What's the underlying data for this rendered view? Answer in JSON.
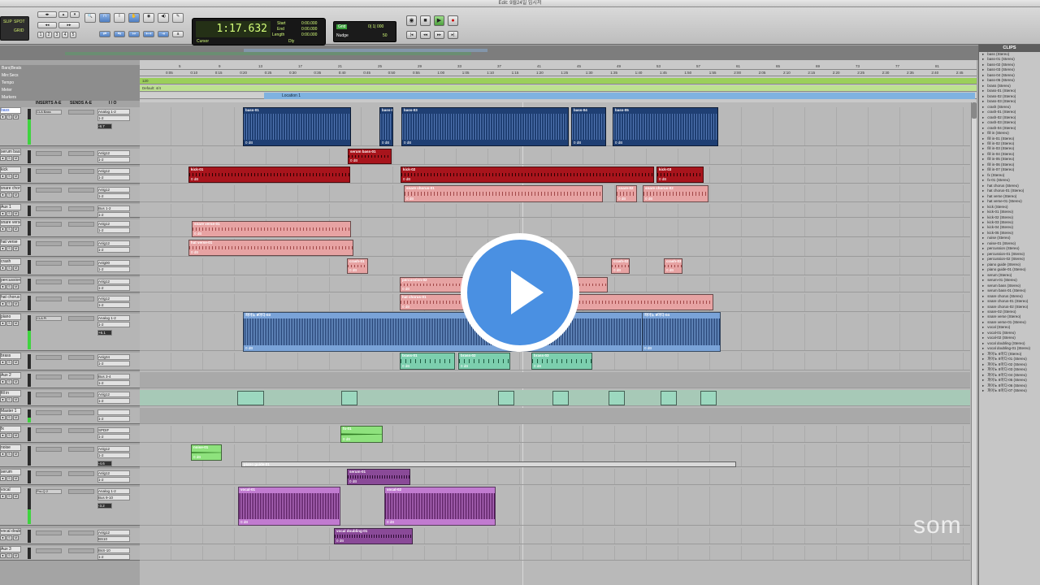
{
  "window": {
    "title": "Edit: 9월24일 임시저"
  },
  "toolbar": {
    "mode_labels": [
      "SLIP",
      "SPOT",
      "GRID"
    ],
    "counter_main": "1:17.632",
    "counter_start_label": "Start",
    "counter_end_label": "End",
    "counter_length_label": "Length",
    "counter_start": "0:00.000",
    "counter_end": "0:00.000",
    "counter_length": "0:00.000",
    "cursor_label": "Cursor",
    "dly_label": "Dly",
    "grid_label": "Grid",
    "grid_value": "0| 1| 000",
    "nudge_label": "Nudge",
    "nudge_value": "50",
    "zoom_buttons": [
      "1",
      "2",
      "3",
      "4",
      "5"
    ]
  },
  "ruler_labels": {
    "header_rows": [
      "Bars|Beats",
      "Min:Secs",
      "Tempo",
      "Meter",
      "Markers"
    ],
    "bars": [
      "5",
      "9",
      "13",
      "17",
      "21",
      "25",
      "29",
      "33",
      "37",
      "41",
      "45",
      "49",
      "53",
      "57",
      "61",
      "65",
      "69",
      "73",
      "77",
      "81"
    ],
    "minsecs": [
      "0:05",
      "0:10",
      "0:15",
      "0:20",
      "0:25",
      "0:30",
      "0:35",
      "0:40",
      "0:45",
      "0:50",
      "0:55",
      "1:00",
      "1:05",
      "1:10",
      "1:15",
      "1:20",
      "1:25",
      "1:30",
      "1:35",
      "1:40",
      "1:45",
      "1:50",
      "1:55",
      "2:00",
      "2:05",
      "2:10",
      "2:15",
      "2:20",
      "2:25",
      "2:30",
      "2:35",
      "2:40",
      "2:45"
    ],
    "tempo": "120",
    "meter": "Default: 4/4",
    "location": "Location 1"
  },
  "column_heads": {
    "inserts": "INSERTS A-E",
    "sends": "SENDS A-E",
    "io": "I / O"
  },
  "tracks": [
    {
      "name": "bass",
      "insert": "CLA Bass",
      "io_in": "Analog 1-2",
      "io_out": "1-2",
      "vol": "-8.7"
    },
    {
      "name": "serum bass",
      "insert": "",
      "io_in": "Anlg12",
      "io_out": "1-2",
      "vol": "-2.6"
    },
    {
      "name": "kick",
      "insert": "",
      "io_in": "Anlg12",
      "io_out": "1-2",
      "vol": "-7.8"
    },
    {
      "name": "snare chorus",
      "insert": "",
      "io_in": "Anlg12",
      "io_out": "1-2",
      "vol": "-8.1"
    },
    {
      "name": "Aux 1",
      "insert": "",
      "io_in": "Bus 1-2",
      "io_out": "1-2",
      "vol": "0.0"
    },
    {
      "name": "snare verse",
      "insert": "",
      "io_in": "Anlg12",
      "io_out": "1-2",
      "vol": "-5.1"
    },
    {
      "name": "hat verse",
      "insert": "",
      "io_in": "Anlg12",
      "io_out": "1-2",
      "vol": "-5.7"
    },
    {
      "name": "crash",
      "insert": "",
      "io_in": "Anlg00",
      "io_out": "1-2",
      "vol": "-4.6"
    },
    {
      "name": "percussion",
      "insert": "",
      "io_in": "Anlg12",
      "io_out": "1-2",
      "vol": "-5.8"
    },
    {
      "name": "hat chorus",
      "insert": "",
      "io_in": "Anlg12",
      "io_out": "1-2",
      "vol": "-7.2"
    },
    {
      "name": "piano",
      "insert": "CLA Pi",
      "io_in": "Analog 1-2",
      "io_out": "1-2",
      "vol": "+6.1"
    },
    {
      "name": "brass",
      "insert": "",
      "io_in": "Anlg34",
      "io_out": "1-2",
      "vol": "-2.6"
    },
    {
      "name": "Aux 2",
      "insert": "",
      "io_in": "Bus 3-4",
      "io_out": "1-2",
      "vol": "0.0"
    },
    {
      "name": "fill in",
      "insert": "",
      "io_in": "Anlg12",
      "io_out": "1-2",
      "vol": "-7.3"
    },
    {
      "name": "Master 1",
      "insert": "",
      "io_in": "",
      "io_out": "1-2",
      "vol": "0.0"
    },
    {
      "name": "fx",
      "insert": "",
      "io_in": "SPDIF",
      "io_out": "1-2",
      "vol": "-6.0"
    },
    {
      "name": "noise",
      "insert": "",
      "io_in": "Anlg12",
      "io_out": "1-2",
      "vol": "-4.6"
    },
    {
      "name": "serum",
      "insert": "",
      "io_in": "Anlg12",
      "io_out": "1-2",
      "vol": "-5.2"
    },
    {
      "name": "vocal",
      "insert": "Pro-Q 2",
      "io_in": "Analog 1-2",
      "io_out": "Bus 9-10",
      "vol": "-3.2"
    },
    {
      "name": "vocal doubling",
      "insert": "",
      "io_in": "Anlg12",
      "io_out": "BS10",
      "vol": "-4.1"
    },
    {
      "name": "Aux 3",
      "insert": "",
      "io_in": "BsS-10",
      "io_out": "1-2",
      "vol": "0.0"
    }
  ],
  "clips": {
    "bass": [
      "bass-01",
      "bass-02",
      "bass-03",
      "bass-04",
      "bass-05"
    ],
    "serum_bass": "serum bass-01",
    "kick": [
      "kick-01",
      "kick-02",
      "kick-03"
    ],
    "snare_chorus": [
      "snare chorus-01",
      "snare-02",
      "snare chorus-02"
    ],
    "snare_verse": "snare verse-01",
    "hat_verse": "hat verse-01",
    "crash": [
      "crash-01",
      "crash-02",
      "crash-03"
    ],
    "percussion": "percussion-02",
    "hat_chorus": "hat chorus-01",
    "piano": [
      "피아노 8마디-03",
      "피아노 8마디-04"
    ],
    "brass": [
      "brass-01",
      "brass-02",
      "brass-03"
    ],
    "fx": "fx-01",
    "noise": "noise-01",
    "piano_guide": "piano guide-01",
    "serum": "serum-01",
    "vocal": [
      "vocal-01",
      "vocal-02"
    ],
    "vocal_doubling": "vocal doubling-01",
    "gain": "0 dB"
  },
  "clip_list": {
    "title": "CLIPS",
    "items": [
      "bass (Stereo)",
      "bass-01 (Stereo)",
      "bass-02 (Stereo)",
      "bass-03 (Stereo)",
      "bass-04 (Stereo)",
      "bass-05 (Stereo)",
      "brass (Stereo)",
      "brass-01 (Stereo)",
      "brass-02 (Stereo)",
      "brass-03 (Stereo)",
      "crash (Stereo)",
      "crash-01 (Stereo)",
      "crash-02 (Stereo)",
      "crash-03 (Stereo)",
      "crash-04 (Stereo)",
      "fill in (Stereo)",
      "fill in-01 (Stereo)",
      "fill in-02 (Stereo)",
      "fill in-03 (Stereo)",
      "fill in-04 (Stereo)",
      "fill in-05 (Stereo)",
      "fill in-06 (Stereo)",
      "fill in-07 (Stereo)",
      "fx (Stereo)",
      "fx-01 (Stereo)",
      "hat chorus (Stereo)",
      "hat chorus-01 (Stereo)",
      "hat verse (Stereo)",
      "hat verse-01 (Stereo)",
      "kick (Stereo)",
      "kick-01 (Stereo)",
      "kick-02 (Stereo)",
      "kick-03 (Stereo)",
      "kick-04 (Stereo)",
      "kick-05 (Stereo)",
      "noise (Stereo)",
      "noise-01 (Stereo)",
      "percussion (Stereo)",
      "percussion-01 (Stereo)",
      "percussion-02 (Stereo)",
      "piano guide (Stereo)",
      "piano guide-01 (Stereo)",
      "serum (Stereo)",
      "serum-01 (Stereo)",
      "serum bass (Stereo)",
      "serum bass-01 (Stereo)",
      "snare chorus (Stereo)",
      "snare chorus-01 (Stereo)",
      "snare chorus-02 (Stereo)",
      "snare-02 (Stereo)",
      "snare verse (Stereo)",
      "snare verse-01 (Stereo)",
      "vocal (Stereo)",
      "vocal-01 (Stereo)",
      "vocal-02 (Stereo)",
      "vocal doubling (Stereo)",
      "vocal doubling-01 (Stereo)",
      "피아노 8마디 (Stereo)",
      "피아노 8마디-01 (Stereo)",
      "피아노 8마디-02 (Stereo)",
      "피아노 8마디-03 (Stereo)",
      "피아노 8마디-04 (Stereo)",
      "피아노 8마디-05 (Stereo)",
      "피아노 8마디-06 (Stereo)",
      "피아노 8마디-07 (Stereo)"
    ]
  },
  "overlay": {
    "watermark": "som"
  }
}
